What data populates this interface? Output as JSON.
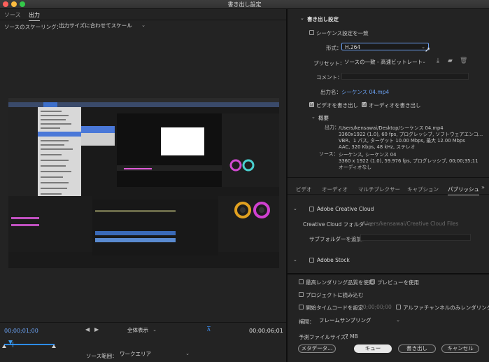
{
  "window": {
    "title": "書き出し設定"
  },
  "source_panel": {
    "tabs": [
      "ソース",
      "出力"
    ],
    "active_tab": "出力",
    "scaling_label": "ソースのスケーリング：",
    "scaling_value": "出力サイズに合わせてスケール",
    "timecode_current": "00;00;01;00",
    "timecode_end": "00;00;06;01",
    "zoom_value": "全体表示",
    "source_range_label": "ソース範囲：",
    "source_range_value": "ワークエリア"
  },
  "export_settings": {
    "header": "書き出し設定",
    "match_sequence_label": "シーケンス設定を一致",
    "format_label": "形式：",
    "format_value": "H.264",
    "preset_label": "プリセット：",
    "preset_value": "ソースの一致 - 高速ビットレート",
    "comment_label": "コメント：",
    "output_name_label": "出力名：",
    "output_name_value": "シーケンス 04.mp4",
    "export_video_label": "ビデオを書き出し",
    "export_audio_label": "オーディオを書き出し",
    "summary_header": "概要",
    "output_label": "出力：",
    "output_lines": [
      "/Users/kensawai/Desktop/シーケンス 04.mp4",
      "3360x1922 (1.0), 60 fps, プログレッシブ, ソフトウェアエンコ...",
      "VBR、1 パス, ターゲット 10.00 Mbps, 最大 12.00 Mbps",
      "AAC, 320 Kbps, 48 kHz, ステレオ"
    ],
    "source_label": "ソース：",
    "source_lines": [
      "シーケンス, シーケンス 04",
      "3360 x 1922 (1.0), 59.976 fps, プログレッシブ, 00;00;35;11",
      "オーディオなし"
    ]
  },
  "settings_tabs": [
    "ビデオ",
    "オーディオ",
    "マルチプレクサー",
    "キャプション",
    "パブリッシュ"
  ],
  "active_settings_tab": "パブリッシュ",
  "publish": {
    "creative_cloud_label": "Adobe Creative Cloud",
    "cc_folder_label": "Creative Cloud フォルダー：",
    "cc_folder_value": "/Users/kensawai/Creative Cloud Files",
    "subfolder_label": "サブフォルダーを追加：",
    "adobe_stock_label": "Adobe Stock"
  },
  "bottom": {
    "max_render_quality": "最高レンダリング品質を使用",
    "use_previews": "プレビューを使用",
    "import_into_project": "プロジェクトに読み込む",
    "set_start_timecode": "開始タイムコードを設定",
    "start_timecode_value": "00;00;00;00",
    "alpha_only": "アルファチャンネルのみレンダリング",
    "interpolation_label": "補間：",
    "interpolation_value": "フレームサンプリング",
    "file_size_label": "予測ファイルサイズ：",
    "file_size_value": "7 MB",
    "metadata_button": "メタデータ...",
    "queue_button": "キュー",
    "export_button": "書き出し",
    "cancel_button": "キャンセル"
  },
  "colors": {
    "accent": "#6aa0f0",
    "timeline_blue": "#2d8cf0"
  }
}
